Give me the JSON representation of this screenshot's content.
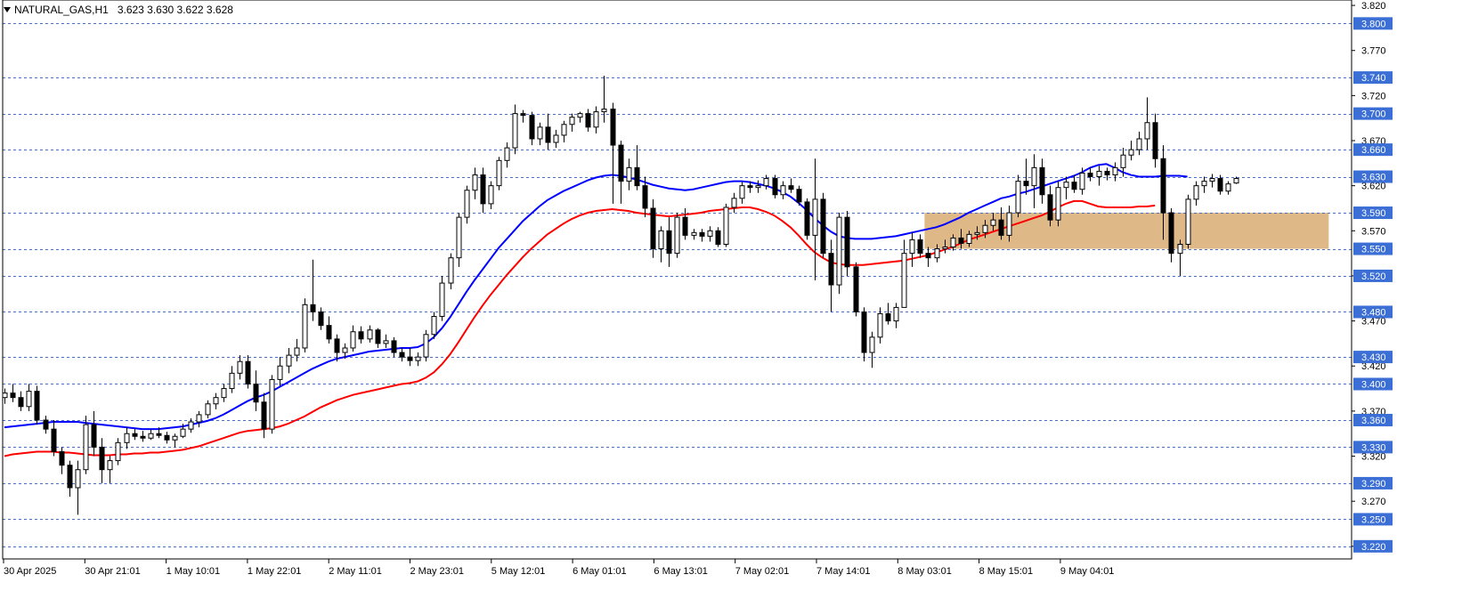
{
  "chart_data": {
    "type": "candlestick",
    "title": "NATURAL_GAS,H1",
    "ohlc_readout": "3.623 3.630 3.622 3.628",
    "ylim": [
      3.206,
      3.826
    ],
    "y_tick_labels": [
      "3.820",
      "3.770",
      "3.720",
      "3.670",
      "3.620",
      "3.570",
      "3.520",
      "3.470",
      "3.420",
      "3.370",
      "3.320",
      "3.270",
      "3.220"
    ],
    "x_tick_labels": [
      "30 Apr 2025",
      "30 Apr 21:01",
      "1 May 10:01",
      "1 May 22:01",
      "2 May 11:01",
      "2 May 23:01",
      "5 May 12:01",
      "6 May 01:01",
      "6 May 13:01",
      "7 May 02:01",
      "7 May 14:01",
      "8 May 03:01",
      "8 May 15:01",
      "9 May 04:01"
    ],
    "horizontal_levels": [
      {
        "value": 3.8,
        "label": "3.800"
      },
      {
        "value": 3.74,
        "label": "3.740"
      },
      {
        "value": 3.7,
        "label": "3.700"
      },
      {
        "value": 3.66,
        "label": "3.660"
      },
      {
        "value": 3.63,
        "label": "3.630"
      },
      {
        "value": 3.59,
        "label": "3.590"
      },
      {
        "value": 3.55,
        "label": "3.550"
      },
      {
        "value": 3.52,
        "label": "3.520"
      },
      {
        "value": 3.48,
        "label": "3.480"
      },
      {
        "value": 3.43,
        "label": "3.430"
      },
      {
        "value": 3.4,
        "label": "3.400"
      },
      {
        "value": 3.36,
        "label": "3.360"
      },
      {
        "value": 3.33,
        "label": "3.330"
      },
      {
        "value": 3.29,
        "label": "3.290"
      },
      {
        "value": 3.25,
        "label": "3.250"
      },
      {
        "value": 3.22,
        "label": "3.220"
      }
    ],
    "zone": {
      "from_bar": 114,
      "to_bar": 163,
      "low": 3.55,
      "high": 3.59
    },
    "candles": [
      [
        3.385,
        3.395,
        3.378,
        3.39
      ],
      [
        3.39,
        3.4,
        3.38,
        3.385
      ],
      [
        3.385,
        3.392,
        3.37,
        3.375
      ],
      [
        3.375,
        3.4,
        3.37,
        3.392
      ],
      [
        3.392,
        3.398,
        3.355,
        3.36
      ],
      [
        3.36,
        3.365,
        3.345,
        3.35
      ],
      [
        3.35,
        3.36,
        3.32,
        3.325
      ],
      [
        3.325,
        3.33,
        3.3,
        3.31
      ],
      [
        3.31,
        3.315,
        3.275,
        3.285
      ],
      [
        3.285,
        3.315,
        3.255,
        3.305
      ],
      [
        3.305,
        3.365,
        3.3,
        3.355
      ],
      [
        3.355,
        3.37,
        3.32,
        3.33
      ],
      [
        3.33,
        3.34,
        3.29,
        3.305
      ],
      [
        3.305,
        3.32,
        3.29,
        3.315
      ],
      [
        3.315,
        3.34,
        3.31,
        3.335
      ],
      [
        3.335,
        3.352,
        3.328,
        3.345
      ],
      [
        3.345,
        3.35,
        3.338,
        3.342
      ],
      [
        3.342,
        3.348,
        3.336,
        3.34
      ],
      [
        3.34,
        3.35,
        3.338,
        3.345
      ],
      [
        3.345,
        3.352,
        3.34,
        3.343
      ],
      [
        3.343,
        3.347,
        3.334,
        3.338
      ],
      [
        3.338,
        3.345,
        3.33,
        3.342
      ],
      [
        3.342,
        3.356,
        3.34,
        3.35
      ],
      [
        3.35,
        3.362,
        3.346,
        3.358
      ],
      [
        3.358,
        3.37,
        3.352,
        3.366
      ],
      [
        3.366,
        3.382,
        3.362,
        3.378
      ],
      [
        3.378,
        3.39,
        3.372,
        3.385
      ],
      [
        3.385,
        3.4,
        3.38,
        3.395
      ],
      [
        3.395,
        3.42,
        3.39,
        3.412
      ],
      [
        3.412,
        3.432,
        3.405,
        3.425
      ],
      [
        3.425,
        3.432,
        3.395,
        3.4
      ],
      [
        3.4,
        3.415,
        3.37,
        3.38
      ],
      [
        3.38,
        3.39,
        3.34,
        3.35
      ],
      [
        3.35,
        3.41,
        3.345,
        3.405
      ],
      [
        3.405,
        3.43,
        3.398,
        3.42
      ],
      [
        3.42,
        3.44,
        3.412,
        3.432
      ],
      [
        3.432,
        3.45,
        3.425,
        3.44
      ],
      [
        3.44,
        3.495,
        3.435,
        3.488
      ],
      [
        3.488,
        3.538,
        3.47,
        3.48
      ],
      [
        3.48,
        3.485,
        3.46,
        3.465
      ],
      [
        3.465,
        3.475,
        3.445,
        3.45
      ],
      [
        3.45,
        3.455,
        3.425,
        3.435
      ],
      [
        3.435,
        3.445,
        3.428,
        3.44
      ],
      [
        3.44,
        3.465,
        3.436,
        3.458
      ],
      [
        3.458,
        3.464,
        3.445,
        3.45
      ],
      [
        3.45,
        3.465,
        3.446,
        3.46
      ],
      [
        3.46,
        3.462,
        3.44,
        3.445
      ],
      [
        3.445,
        3.455,
        3.44,
        3.448
      ],
      [
        3.448,
        3.452,
        3.43,
        3.435
      ],
      [
        3.435,
        3.44,
        3.425,
        3.43
      ],
      [
        3.43,
        3.44,
        3.42,
        3.426
      ],
      [
        3.426,
        3.435,
        3.42,
        3.43
      ],
      [
        3.43,
        3.46,
        3.425,
        3.455
      ],
      [
        3.455,
        3.48,
        3.45,
        3.475
      ],
      [
        3.475,
        3.52,
        3.47,
        3.512
      ],
      [
        3.512,
        3.545,
        3.505,
        3.54
      ],
      [
        3.54,
        3.59,
        3.53,
        3.585
      ],
      [
        3.585,
        3.62,
        3.578,
        3.615
      ],
      [
        3.615,
        3.64,
        3.605,
        3.632
      ],
      [
        3.632,
        3.64,
        3.59,
        3.6
      ],
      [
        3.6,
        3.625,
        3.594,
        3.62
      ],
      [
        3.62,
        3.652,
        3.615,
        3.648
      ],
      [
        3.648,
        3.668,
        3.64,
        3.662
      ],
      [
        3.662,
        3.71,
        3.655,
        3.7
      ],
      [
        3.7,
        3.704,
        3.69,
        3.698
      ],
      [
        3.698,
        3.702,
        3.665,
        3.672
      ],
      [
        3.672,
        3.69,
        3.665,
        3.685
      ],
      [
        3.685,
        3.7,
        3.66,
        3.668
      ],
      [
        3.668,
        3.682,
        3.662,
        3.676
      ],
      [
        3.676,
        3.692,
        3.668,
        3.688
      ],
      [
        3.688,
        3.7,
        3.68,
        3.696
      ],
      [
        3.696,
        3.702,
        3.69,
        3.7
      ],
      [
        3.7,
        3.705,
        3.68,
        3.685
      ],
      [
        3.685,
        3.708,
        3.678,
        3.702
      ],
      [
        3.702,
        3.742,
        3.69,
        3.705
      ],
      [
        3.705,
        3.712,
        3.6,
        3.665
      ],
      [
        3.665,
        3.67,
        3.6,
        3.625
      ],
      [
        3.625,
        3.65,
        3.615,
        3.64
      ],
      [
        3.64,
        3.665,
        3.615,
        3.62
      ],
      [
        3.62,
        3.63,
        3.585,
        3.595
      ],
      [
        3.595,
        3.605,
        3.54,
        3.55
      ],
      [
        3.55,
        3.575,
        3.535,
        3.57
      ],
      [
        3.57,
        3.585,
        3.53,
        3.545
      ],
      [
        3.545,
        3.59,
        3.54,
        3.585
      ],
      [
        3.585,
        3.595,
        3.56,
        3.565
      ],
      [
        3.565,
        3.572,
        3.56,
        3.568
      ],
      [
        3.568,
        3.572,
        3.558,
        3.564
      ],
      [
        3.564,
        3.575,
        3.558,
        3.57
      ],
      [
        3.57,
        3.574,
        3.552,
        3.555
      ],
      [
        3.555,
        3.6,
        3.552,
        3.596
      ],
      [
        3.596,
        3.612,
        3.59,
        3.606
      ],
      [
        3.606,
        3.624,
        3.6,
        3.62
      ],
      [
        3.62,
        3.625,
        3.612,
        3.618
      ],
      [
        3.618,
        3.626,
        3.612,
        3.62
      ],
      [
        3.62,
        3.632,
        3.616,
        3.628
      ],
      [
        3.628,
        3.632,
        3.606,
        3.61
      ],
      [
        3.61,
        3.625,
        3.605,
        3.62
      ],
      [
        3.62,
        3.628,
        3.612,
        3.616
      ],
      [
        3.616,
        3.62,
        3.598,
        3.602
      ],
      [
        3.602,
        3.606,
        3.56,
        3.565
      ],
      [
        3.565,
        3.65,
        3.515,
        3.605
      ],
      [
        3.605,
        3.612,
        3.54,
        3.545
      ],
      [
        3.545,
        3.56,
        3.48,
        3.51
      ],
      [
        3.51,
        3.59,
        3.5,
        3.585
      ],
      [
        3.585,
        3.592,
        3.52,
        3.53
      ],
      [
        3.53,
        3.535,
        3.475,
        3.48
      ],
      [
        3.48,
        3.485,
        3.425,
        3.435
      ],
      [
        3.435,
        3.458,
        3.418,
        3.452
      ],
      [
        3.452,
        3.485,
        3.445,
        3.478
      ],
      [
        3.478,
        3.49,
        3.466,
        3.47
      ],
      [
        3.47,
        3.49,
        3.462,
        3.485
      ],
      [
        3.485,
        3.56,
        3.5,
        3.545
      ],
      [
        3.545,
        3.568,
        3.53,
        3.56
      ],
      [
        3.56,
        3.566,
        3.54,
        3.545
      ],
      [
        3.545,
        3.552,
        3.53,
        3.54
      ],
      [
        3.54,
        3.555,
        3.535,
        3.55
      ],
      [
        3.55,
        3.56,
        3.545,
        3.552
      ],
      [
        3.552,
        3.566,
        3.548,
        3.562
      ],
      [
        3.562,
        3.572,
        3.55,
        3.556
      ],
      [
        3.556,
        3.57,
        3.552,
        3.566
      ],
      [
        3.566,
        3.575,
        3.56,
        3.568
      ],
      [
        3.568,
        3.582,
        3.562,
        3.576
      ],
      [
        3.576,
        3.59,
        3.57,
        3.582
      ],
      [
        3.582,
        3.596,
        3.56,
        3.565
      ],
      [
        3.565,
        3.598,
        3.558,
        3.59
      ],
      [
        3.59,
        3.632,
        3.585,
        3.625
      ],
      [
        3.625,
        3.65,
        3.61,
        3.62
      ],
      [
        3.62,
        3.655,
        3.595,
        3.64
      ],
      [
        3.64,
        3.65,
        3.6,
        3.61
      ],
      [
        3.61,
        3.62,
        3.575,
        3.582
      ],
      [
        3.582,
        3.625,
        3.575,
        3.618
      ],
      [
        3.618,
        3.63,
        3.605,
        3.624
      ],
      [
        3.624,
        3.632,
        3.612,
        3.616
      ],
      [
        3.616,
        3.64,
        3.61,
        3.634
      ],
      [
        3.634,
        3.64,
        3.625,
        3.63
      ],
      [
        3.63,
        3.642,
        3.62,
        3.636
      ],
      [
        3.636,
        3.64,
        3.626,
        3.632
      ],
      [
        3.632,
        3.646,
        3.625,
        3.64
      ],
      [
        3.64,
        3.662,
        3.63,
        3.654
      ],
      [
        3.654,
        3.67,
        3.648,
        3.66
      ],
      [
        3.66,
        3.68,
        3.654,
        3.672
      ],
      [
        3.672,
        3.718,
        3.66,
        3.69
      ],
      [
        3.69,
        3.7,
        3.64,
        3.65
      ],
      [
        3.65,
        3.665,
        3.56,
        3.59
      ],
      [
        3.59,
        3.595,
        3.535,
        3.545
      ],
      [
        3.545,
        3.56,
        3.52,
        3.555
      ],
      [
        3.555,
        3.61,
        3.55,
        3.605
      ],
      [
        3.605,
        3.625,
        3.598,
        3.62
      ],
      [
        3.62,
        3.63,
        3.612,
        3.625
      ],
      [
        3.625,
        3.633,
        3.618,
        3.628
      ],
      [
        3.628,
        3.632,
        3.61,
        3.614
      ],
      [
        3.614,
        3.625,
        3.61,
        3.622
      ],
      [
        3.623,
        3.63,
        3.622,
        3.628
      ]
    ],
    "series": [
      {
        "name": "",
        "color": "#0000ff",
        "values": [
          3.352,
          3.353,
          3.354,
          3.355,
          3.356,
          3.357,
          3.358,
          3.358,
          3.358,
          3.358,
          3.357,
          3.356,
          3.355,
          3.354,
          3.353,
          3.352,
          3.351,
          3.35,
          3.35,
          3.35,
          3.351,
          3.352,
          3.353,
          3.355,
          3.357,
          3.359,
          3.362,
          3.366,
          3.371,
          3.376,
          3.381,
          3.385,
          3.388,
          3.392,
          3.397,
          3.402,
          3.407,
          3.412,
          3.417,
          3.421,
          3.425,
          3.428,
          3.43,
          3.432,
          3.434,
          3.436,
          3.437,
          3.438,
          3.439,
          3.44,
          3.44,
          3.441,
          3.445,
          3.452,
          3.462,
          3.474,
          3.488,
          3.502,
          3.515,
          3.527,
          3.539,
          3.551,
          3.561,
          3.571,
          3.581,
          3.589,
          3.597,
          3.604,
          3.609,
          3.614,
          3.618,
          3.622,
          3.626,
          3.629,
          3.631,
          3.632,
          3.631,
          3.629,
          3.627,
          3.624,
          3.621,
          3.619,
          3.617,
          3.616,
          3.615,
          3.616,
          3.618,
          3.62,
          3.622,
          3.624,
          3.625,
          3.625,
          3.624,
          3.622,
          3.62,
          3.617,
          3.613,
          3.608,
          3.601,
          3.593,
          3.584,
          3.576,
          3.569,
          3.564,
          3.562,
          3.561,
          3.561,
          3.561,
          3.562,
          3.563,
          3.564,
          3.566,
          3.568,
          3.57,
          3.572,
          3.574,
          3.577,
          3.581,
          3.585,
          3.59,
          3.594,
          3.598,
          3.602,
          3.606,
          3.608,
          3.611,
          3.613,
          3.616,
          3.619,
          3.622,
          3.625,
          3.628,
          3.631,
          3.635,
          3.64,
          3.643,
          3.644,
          3.64,
          3.635,
          3.632,
          3.63,
          3.63,
          3.63,
          3.631,
          3.631,
          3.631,
          3.63
        ]
      },
      {
        "name": "",
        "color": "#ff0000",
        "values": [
          3.32,
          3.322,
          3.323,
          3.324,
          3.325,
          3.325,
          3.325,
          3.324,
          3.324,
          3.323,
          3.322,
          3.321,
          3.321,
          3.321,
          3.322,
          3.322,
          3.323,
          3.323,
          3.324,
          3.324,
          3.325,
          3.326,
          3.327,
          3.329,
          3.331,
          3.334,
          3.337,
          3.34,
          3.343,
          3.346,
          3.348,
          3.349,
          3.35,
          3.351,
          3.353,
          3.356,
          3.36,
          3.364,
          3.369,
          3.374,
          3.378,
          3.382,
          3.385,
          3.388,
          3.39,
          3.392,
          3.394,
          3.396,
          3.398,
          3.4,
          3.401,
          3.403,
          3.407,
          3.413,
          3.422,
          3.433,
          3.446,
          3.46,
          3.474,
          3.487,
          3.499,
          3.51,
          3.521,
          3.531,
          3.541,
          3.55,
          3.558,
          3.566,
          3.572,
          3.578,
          3.583,
          3.587,
          3.59,
          3.592,
          3.593,
          3.594,
          3.593,
          3.592,
          3.59,
          3.589,
          3.588,
          3.587,
          3.586,
          3.587,
          3.588,
          3.589,
          3.59,
          3.592,
          3.593,
          3.594,
          3.595,
          3.596,
          3.596,
          3.594,
          3.591,
          3.587,
          3.581,
          3.574,
          3.565,
          3.555,
          3.546,
          3.54,
          3.535,
          3.533,
          3.532,
          3.532,
          3.532,
          3.533,
          3.534,
          3.535,
          3.536,
          3.537,
          3.539,
          3.541,
          3.543,
          3.546,
          3.549,
          3.552,
          3.556,
          3.56,
          3.563,
          3.566,
          3.569,
          3.572,
          3.575,
          3.578,
          3.581,
          3.584,
          3.587,
          3.591,
          3.596,
          3.6,
          3.603,
          3.603,
          3.6,
          3.597,
          3.596,
          3.596,
          3.596,
          3.596,
          3.597,
          3.597,
          3.598
        ]
      }
    ]
  }
}
